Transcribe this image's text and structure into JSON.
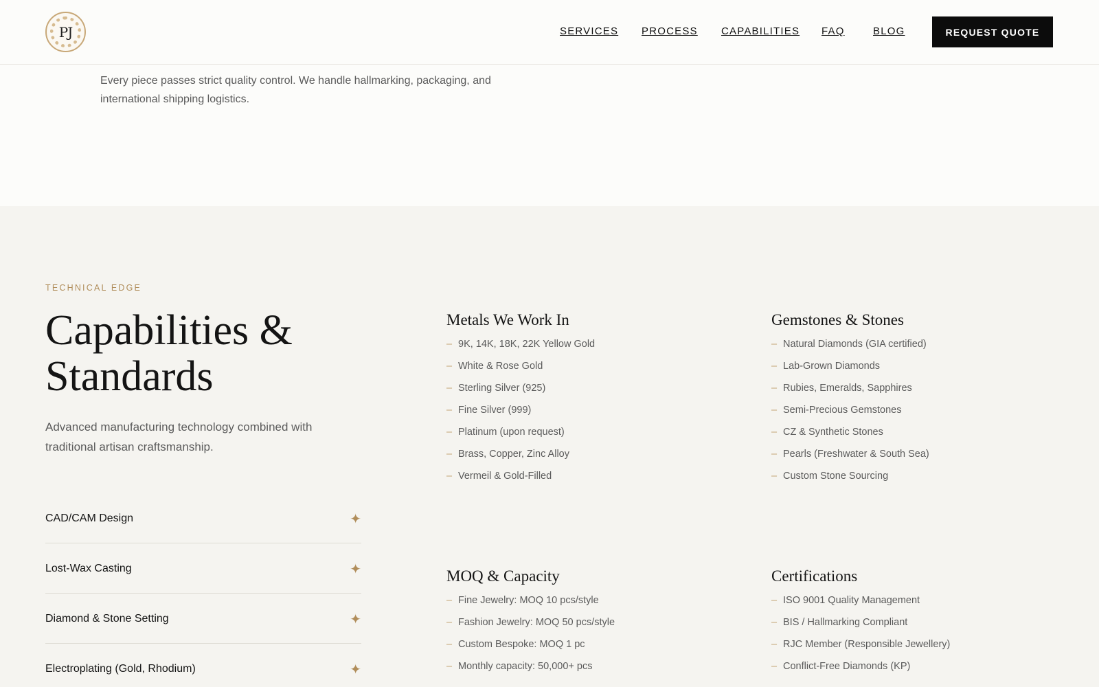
{
  "header": {
    "logo_text": "PJ",
    "nav": [
      "SERVICES",
      "PROCESS",
      "CAPABILITIES",
      "FAQ",
      "BLOG"
    ],
    "cta": "REQUEST QUOTE"
  },
  "top_section": {
    "text": "Every piece passes strict quality control. We handle hallmarking, packaging, and international shipping logistics."
  },
  "capabilities": {
    "eyebrow": "TECHNICAL EDGE",
    "title": "Capabilities & Standards",
    "description": "Advanced manufacturing technology combined with traditional artisan craftsmanship.",
    "accordion": [
      "CAD/CAM Design",
      "Lost-Wax Casting",
      "Diamond & Stone Setting",
      "Electroplating (Gold, Rhodium)"
    ],
    "blocks": [
      {
        "title": "Metals We Work In",
        "items": [
          "9K, 14K, 18K, 22K Yellow Gold",
          "White & Rose Gold",
          "Sterling Silver (925)",
          "Fine Silver (999)",
          "Platinum (upon request)",
          "Brass, Copper, Zinc Alloy",
          "Vermeil & Gold-Filled"
        ]
      },
      {
        "title": "Gemstones & Stones",
        "items": [
          "Natural Diamonds (GIA certified)",
          "Lab-Grown Diamonds",
          "Rubies, Emeralds, Sapphires",
          "Semi-Precious Gemstones",
          "CZ & Synthetic Stones",
          "Pearls (Freshwater & South Sea)",
          "Custom Stone Sourcing"
        ]
      },
      {
        "title": "MOQ & Capacity",
        "items": [
          "Fine Jewelry: MOQ 10 pcs/style",
          "Fashion Jewelry: MOQ 50 pcs/style",
          "Custom Bespoke: MOQ 1 pc",
          "Monthly capacity: 50,000+ pcs"
        ]
      },
      {
        "title": "Certifications",
        "items": [
          "ISO 9001 Quality Management",
          "BIS / Hallmarking Compliant",
          "RJC Member (Responsible Jewellery)",
          "Conflict-Free Diamonds (KP)"
        ]
      }
    ],
    "dash": "–",
    "plus_icon": "✦"
  },
  "colors": {
    "accent": "#b08d5a",
    "dark": "#0c0c0c",
    "background": "#f5f4f0",
    "header_bg": "#fcfcfa"
  }
}
